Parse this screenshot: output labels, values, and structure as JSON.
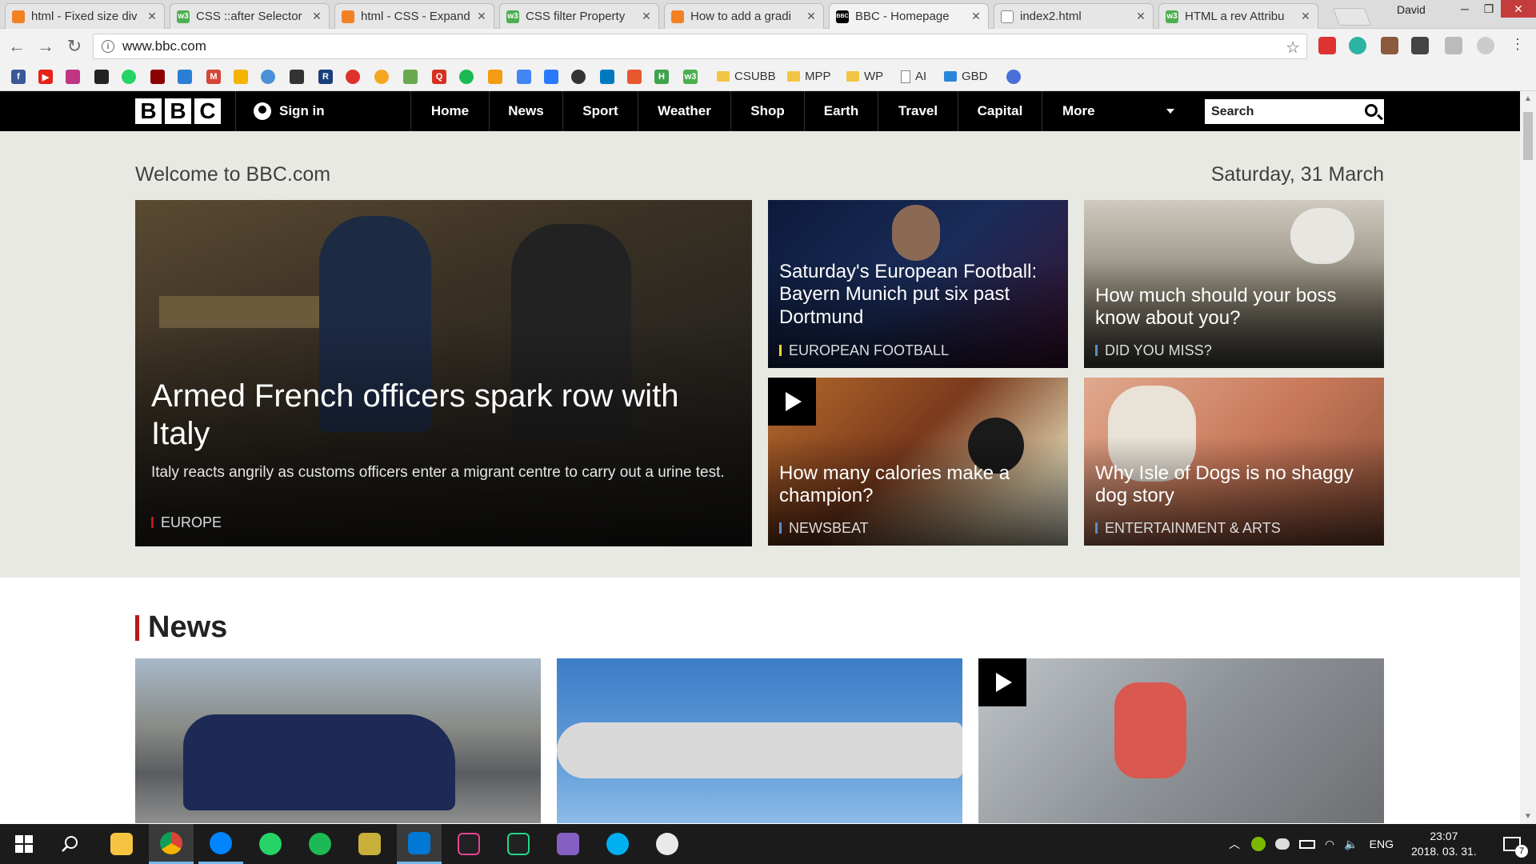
{
  "browser": {
    "tabs": [
      {
        "title": "html - Fixed size div",
        "favicon": "stackoverflow-icon",
        "color": "#f48024"
      },
      {
        "title": "CSS ::after Selector",
        "favicon": "w3schools-icon",
        "color": "#4caf50"
      },
      {
        "title": "html - CSS - Expand",
        "favicon": "stackoverflow-icon",
        "color": "#f48024"
      },
      {
        "title": "CSS filter Property",
        "favicon": "w3schools-icon",
        "color": "#4caf50"
      },
      {
        "title": "How to add a gradi",
        "favicon": "stackoverflow-icon",
        "color": "#f48024"
      },
      {
        "title": "BBC - Homepage",
        "favicon": "bbc-icon",
        "color": "#000000"
      },
      {
        "title": "index2.html",
        "favicon": "page-icon",
        "color": "#888888"
      },
      {
        "title": "HTML a rev Attribu",
        "favicon": "w3schools-icon",
        "color": "#4caf50"
      }
    ],
    "active_tab": 5,
    "profile_name": "David",
    "url": "www.bbc.com",
    "bookmark_folders": [
      "CSUBB",
      "MPP",
      "WP",
      "AI",
      "GBD"
    ]
  },
  "bbc": {
    "logo": [
      "B",
      "B",
      "C"
    ],
    "sign_in": "Sign in",
    "nav": [
      "Home",
      "News",
      "Sport",
      "Weather",
      "Shop",
      "Earth",
      "Travel",
      "Capital",
      "More"
    ],
    "search_placeholder": "Search",
    "welcome": "Welcome to BBC.com",
    "date": "Saturday, 31 March",
    "hero": {
      "main": {
        "title": "Armed French officers spark row with Italy",
        "summary": "Italy reacts angrily as customs officers enter a migrant centre to carry out a urine test.",
        "tag": "EUROPE",
        "tag_color": "#bb1919"
      },
      "cards": [
        {
          "title": "Saturday's European Football: Bayern Munich put six past Dortmund",
          "tag": "EUROPEAN FOOTBALL",
          "tag_color": "#ffd230",
          "video": false
        },
        {
          "title": "How much should your boss know about you?",
          "tag": "DID YOU MISS?",
          "tag_color": "#5a8dc8",
          "video": false
        },
        {
          "title": "How many calories make a champion?",
          "tag": "NEWSBEAT",
          "tag_color": "#5a8dc8",
          "video": true
        },
        {
          "title": "Why Isle of Dogs is no shaggy dog story",
          "tag": "ENTERTAINMENT & ARTS",
          "tag_color": "#5a8dc8",
          "video": false
        }
      ]
    },
    "news_heading": "News"
  },
  "taskbar": {
    "language": "ENG",
    "time": "23:07",
    "date": "2018. 03. 31.",
    "notification_count": "7"
  },
  "colors": {
    "bbc_red": "#bb1919",
    "masthead": "#000000",
    "hero_bg": "#e9e9e3"
  }
}
